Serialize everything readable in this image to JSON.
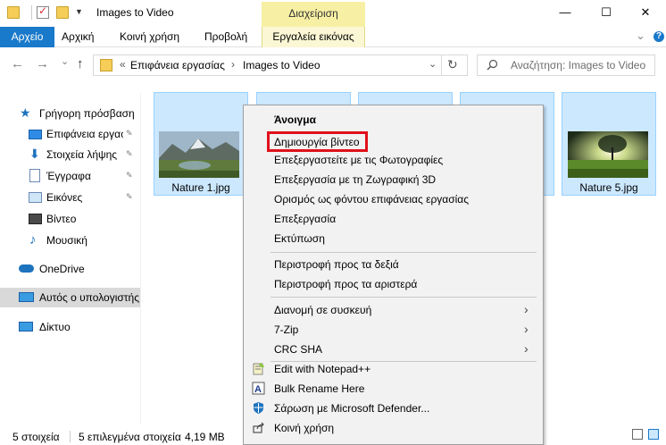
{
  "window": {
    "title": "Images to Video",
    "manage_tab": "Διαχείριση",
    "minimize": "—",
    "maximize": "☐",
    "close": "✕"
  },
  "ribbon": {
    "tabs": [
      "Αρχείο",
      "Αρχική",
      "Κοινή χρήση",
      "Προβολή",
      "Εργαλεία εικόνας"
    ],
    "collapse_glyph": "⌄",
    "help_glyph": "?"
  },
  "nav": {
    "back": "←",
    "forward": "→",
    "recent": "⌄",
    "up": "↑",
    "overflow": "«",
    "crumbs": [
      "Επιφάνεια εργασίας",
      "Images to Video"
    ],
    "crumb_sep": "›",
    "dropdown": "⌄",
    "refresh": "↻",
    "search_placeholder": "Αναζήτηση: Images to Video"
  },
  "sidebar": {
    "items": [
      {
        "label": "Γρήγορη πρόσβαση",
        "icon": "star-icon",
        "pinned": false
      },
      {
        "label": "Επιφάνεια εργασ",
        "icon": "desktop-icon",
        "pinned": true
      },
      {
        "label": "Στοιχεία λήψης",
        "icon": "download-icon",
        "pinned": true
      },
      {
        "label": "Έγγραφα",
        "icon": "documents-icon",
        "pinned": true
      },
      {
        "label": "Εικόνες",
        "icon": "pictures-icon",
        "pinned": true
      },
      {
        "label": "Βίντεο",
        "icon": "videos-icon",
        "pinned": false
      },
      {
        "label": "Μουσική",
        "icon": "music-icon",
        "pinned": false
      },
      {
        "label": "OneDrive",
        "icon": "cloud-icon",
        "pinned": false
      },
      {
        "label": "Αυτός ο υπολογιστής",
        "icon": "computer-icon",
        "pinned": false
      },
      {
        "label": "Δίκτυο",
        "icon": "network-icon",
        "pinned": false
      }
    ],
    "pin_glyph": "📌"
  },
  "files": [
    {
      "name": "Nature 1.jpg",
      "visible": true
    },
    {
      "name": "",
      "visible": false
    },
    {
      "name": "",
      "visible": false
    },
    {
      "name": "",
      "visible": false
    },
    {
      "name": "Nature 5.jpg",
      "visible": true
    }
  ],
  "context_menu": {
    "items": [
      {
        "label": "Άνοιγμα",
        "bold": true
      },
      {
        "label": "Δημιουργία βίντεο"
      },
      {
        "label": "Επεξεργαστείτε με τις Φωτογραφίες"
      },
      {
        "label": "Επεξεργασία με τη Ζωγραφική 3D"
      },
      {
        "label": "Ορισμός ως φόντου επιφάνειας εργασίας"
      },
      {
        "label": "Επεξεργασία"
      },
      {
        "label": "Εκτύπωση"
      },
      {
        "label": "Περιστροφή προς τα δεξιά"
      },
      {
        "label": "Περιστροφή προς τα αριστερά"
      },
      {
        "label": "Διανομή σε συσκευή",
        "submenu": true
      },
      {
        "label": "7-Zip",
        "submenu": true
      },
      {
        "label": "CRC SHA",
        "submenu": true
      },
      {
        "label": "Edit with Notepad++",
        "icon": "notepadpp-icon"
      },
      {
        "label": "Bulk Rename Here",
        "icon": "bulk-rename-icon"
      },
      {
        "label": "Σάρωση με Microsoft Defender...",
        "icon": "defender-icon"
      },
      {
        "label": "Κοινή χρήση",
        "icon": "share-icon"
      }
    ],
    "submenu_glyph": "›",
    "highlighted": "Δημιουργία βίντεο"
  },
  "status": {
    "count": "5 στοιχεία",
    "selection": "5 επιλεγμένα στοιχεία",
    "size": "4,19 MB"
  },
  "colors": {
    "file_tab": "#1979ca",
    "manage_tab": "#f7f0a4",
    "selection": "#cce8ff",
    "highlight_box": "#e0111b"
  }
}
